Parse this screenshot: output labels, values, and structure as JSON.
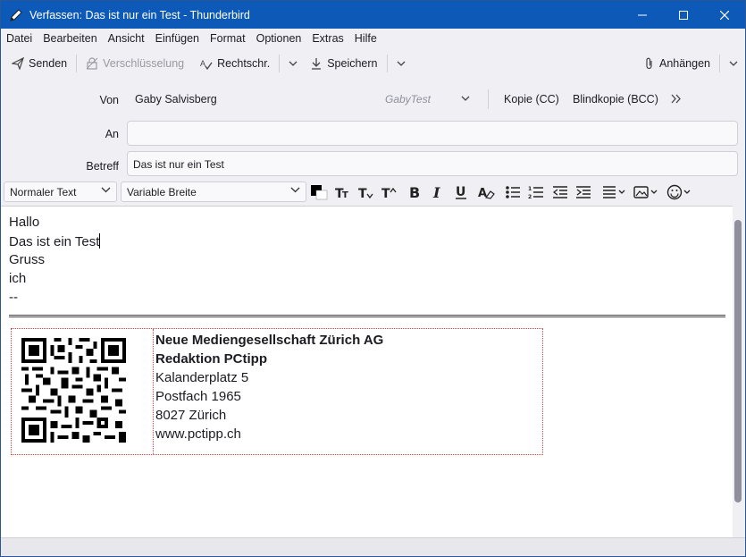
{
  "window": {
    "title": "Verfassen: Das ist nur ein Test - Thunderbird"
  },
  "menu": {
    "items": [
      "Datei",
      "Bearbeiten",
      "Ansicht",
      "Einfügen",
      "Format",
      "Optionen",
      "Extras",
      "Hilfe"
    ]
  },
  "toolbar": {
    "send_label": "Senden",
    "encrypt_label": "Verschlüsselung",
    "spellcheck_label": "Rechtschr.",
    "save_label": "Speichern",
    "attach_label": "Anhängen"
  },
  "header": {
    "from_label": "Von",
    "from_name": "Gaby Salvisberg",
    "identity": "GabyTest",
    "cc_label": "Kopie (CC)",
    "bcc_label": "Blindkopie (BCC)",
    "to_label": "An",
    "to_value": "",
    "subject_label": "Betreff",
    "subject_value": "Das ist nur ein Test"
  },
  "format": {
    "paragraph_style": "Normaler Text",
    "font": "Variable Breite"
  },
  "body": {
    "lines": [
      "Hallo",
      "Das ist ein Test",
      "Gruss",
      "ich",
      "--"
    ]
  },
  "signature": {
    "lines": [
      "Neue Mediengesellschaft Zürich AG",
      "Redaktion PCtipp",
      "Kalanderplatz 5",
      "Postfach 1965",
      "8027 Zürich",
      "www.pctipp.ch"
    ]
  },
  "colors": {
    "titlebar": "#0c59b8",
    "signature_border": "#dd4444"
  }
}
